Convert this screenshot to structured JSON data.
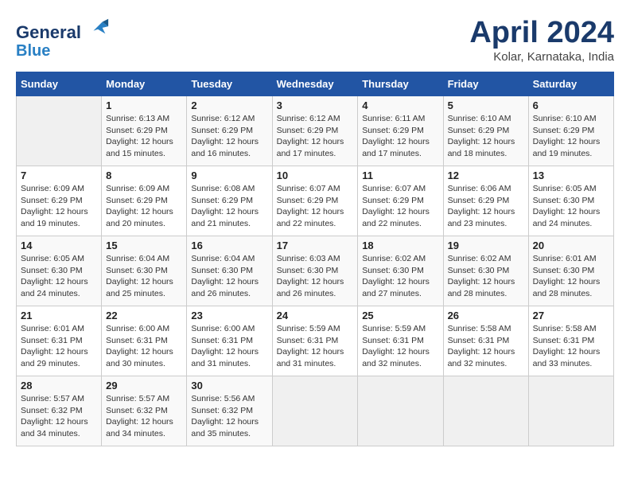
{
  "header": {
    "logo_line1": "General",
    "logo_line2": "Blue",
    "month": "April 2024",
    "location": "Kolar, Karnataka, India"
  },
  "days_of_week": [
    "Sunday",
    "Monday",
    "Tuesday",
    "Wednesday",
    "Thursday",
    "Friday",
    "Saturday"
  ],
  "weeks": [
    [
      {
        "num": "",
        "sunrise": "",
        "sunset": "",
        "daylight": ""
      },
      {
        "num": "1",
        "sunrise": "Sunrise: 6:13 AM",
        "sunset": "Sunset: 6:29 PM",
        "daylight": "Daylight: 12 hours and 15 minutes."
      },
      {
        "num": "2",
        "sunrise": "Sunrise: 6:12 AM",
        "sunset": "Sunset: 6:29 PM",
        "daylight": "Daylight: 12 hours and 16 minutes."
      },
      {
        "num": "3",
        "sunrise": "Sunrise: 6:12 AM",
        "sunset": "Sunset: 6:29 PM",
        "daylight": "Daylight: 12 hours and 17 minutes."
      },
      {
        "num": "4",
        "sunrise": "Sunrise: 6:11 AM",
        "sunset": "Sunset: 6:29 PM",
        "daylight": "Daylight: 12 hours and 17 minutes."
      },
      {
        "num": "5",
        "sunrise": "Sunrise: 6:10 AM",
        "sunset": "Sunset: 6:29 PM",
        "daylight": "Daylight: 12 hours and 18 minutes."
      },
      {
        "num": "6",
        "sunrise": "Sunrise: 6:10 AM",
        "sunset": "Sunset: 6:29 PM",
        "daylight": "Daylight: 12 hours and 19 minutes."
      }
    ],
    [
      {
        "num": "7",
        "sunrise": "Sunrise: 6:09 AM",
        "sunset": "Sunset: 6:29 PM",
        "daylight": "Daylight: 12 hours and 19 minutes."
      },
      {
        "num": "8",
        "sunrise": "Sunrise: 6:09 AM",
        "sunset": "Sunset: 6:29 PM",
        "daylight": "Daylight: 12 hours and 20 minutes."
      },
      {
        "num": "9",
        "sunrise": "Sunrise: 6:08 AM",
        "sunset": "Sunset: 6:29 PM",
        "daylight": "Daylight: 12 hours and 21 minutes."
      },
      {
        "num": "10",
        "sunrise": "Sunrise: 6:07 AM",
        "sunset": "Sunset: 6:29 PM",
        "daylight": "Daylight: 12 hours and 22 minutes."
      },
      {
        "num": "11",
        "sunrise": "Sunrise: 6:07 AM",
        "sunset": "Sunset: 6:29 PM",
        "daylight": "Daylight: 12 hours and 22 minutes."
      },
      {
        "num": "12",
        "sunrise": "Sunrise: 6:06 AM",
        "sunset": "Sunset: 6:29 PM",
        "daylight": "Daylight: 12 hours and 23 minutes."
      },
      {
        "num": "13",
        "sunrise": "Sunrise: 6:05 AM",
        "sunset": "Sunset: 6:30 PM",
        "daylight": "Daylight: 12 hours and 24 minutes."
      }
    ],
    [
      {
        "num": "14",
        "sunrise": "Sunrise: 6:05 AM",
        "sunset": "Sunset: 6:30 PM",
        "daylight": "Daylight: 12 hours and 24 minutes."
      },
      {
        "num": "15",
        "sunrise": "Sunrise: 6:04 AM",
        "sunset": "Sunset: 6:30 PM",
        "daylight": "Daylight: 12 hours and 25 minutes."
      },
      {
        "num": "16",
        "sunrise": "Sunrise: 6:04 AM",
        "sunset": "Sunset: 6:30 PM",
        "daylight": "Daylight: 12 hours and 26 minutes."
      },
      {
        "num": "17",
        "sunrise": "Sunrise: 6:03 AM",
        "sunset": "Sunset: 6:30 PM",
        "daylight": "Daylight: 12 hours and 26 minutes."
      },
      {
        "num": "18",
        "sunrise": "Sunrise: 6:02 AM",
        "sunset": "Sunset: 6:30 PM",
        "daylight": "Daylight: 12 hours and 27 minutes."
      },
      {
        "num": "19",
        "sunrise": "Sunrise: 6:02 AM",
        "sunset": "Sunset: 6:30 PM",
        "daylight": "Daylight: 12 hours and 28 minutes."
      },
      {
        "num": "20",
        "sunrise": "Sunrise: 6:01 AM",
        "sunset": "Sunset: 6:30 PM",
        "daylight": "Daylight: 12 hours and 28 minutes."
      }
    ],
    [
      {
        "num": "21",
        "sunrise": "Sunrise: 6:01 AM",
        "sunset": "Sunset: 6:31 PM",
        "daylight": "Daylight: 12 hours and 29 minutes."
      },
      {
        "num": "22",
        "sunrise": "Sunrise: 6:00 AM",
        "sunset": "Sunset: 6:31 PM",
        "daylight": "Daylight: 12 hours and 30 minutes."
      },
      {
        "num": "23",
        "sunrise": "Sunrise: 6:00 AM",
        "sunset": "Sunset: 6:31 PM",
        "daylight": "Daylight: 12 hours and 31 minutes."
      },
      {
        "num": "24",
        "sunrise": "Sunrise: 5:59 AM",
        "sunset": "Sunset: 6:31 PM",
        "daylight": "Daylight: 12 hours and 31 minutes."
      },
      {
        "num": "25",
        "sunrise": "Sunrise: 5:59 AM",
        "sunset": "Sunset: 6:31 PM",
        "daylight": "Daylight: 12 hours and 32 minutes."
      },
      {
        "num": "26",
        "sunrise": "Sunrise: 5:58 AM",
        "sunset": "Sunset: 6:31 PM",
        "daylight": "Daylight: 12 hours and 32 minutes."
      },
      {
        "num": "27",
        "sunrise": "Sunrise: 5:58 AM",
        "sunset": "Sunset: 6:31 PM",
        "daylight": "Daylight: 12 hours and 33 minutes."
      }
    ],
    [
      {
        "num": "28",
        "sunrise": "Sunrise: 5:57 AM",
        "sunset": "Sunset: 6:32 PM",
        "daylight": "Daylight: 12 hours and 34 minutes."
      },
      {
        "num": "29",
        "sunrise": "Sunrise: 5:57 AM",
        "sunset": "Sunset: 6:32 PM",
        "daylight": "Daylight: 12 hours and 34 minutes."
      },
      {
        "num": "30",
        "sunrise": "Sunrise: 5:56 AM",
        "sunset": "Sunset: 6:32 PM",
        "daylight": "Daylight: 12 hours and 35 minutes."
      },
      {
        "num": "",
        "sunrise": "",
        "sunset": "",
        "daylight": ""
      },
      {
        "num": "",
        "sunrise": "",
        "sunset": "",
        "daylight": ""
      },
      {
        "num": "",
        "sunrise": "",
        "sunset": "",
        "daylight": ""
      },
      {
        "num": "",
        "sunrise": "",
        "sunset": "",
        "daylight": ""
      }
    ]
  ]
}
